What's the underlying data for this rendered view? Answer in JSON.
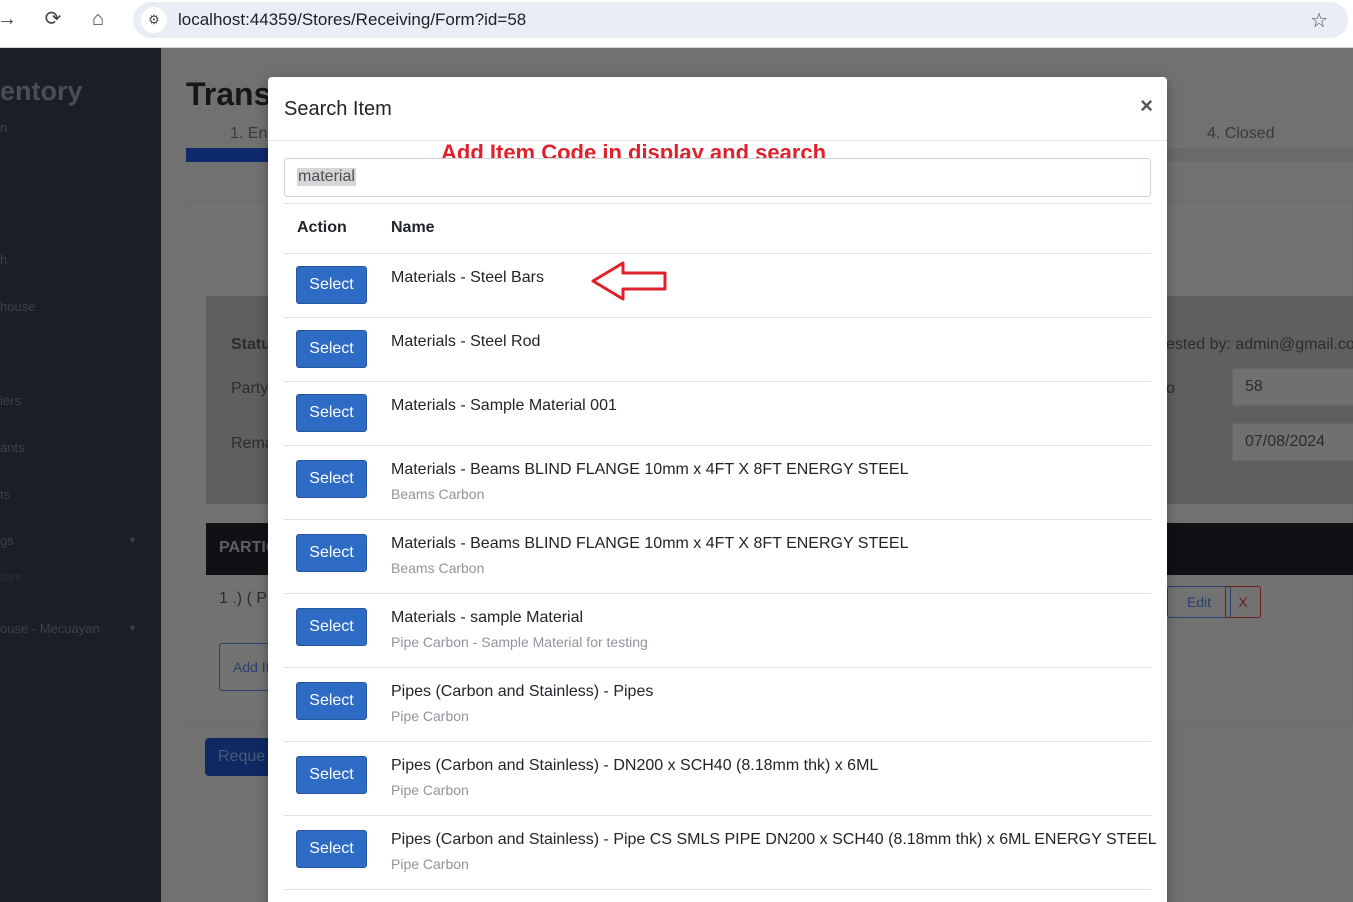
{
  "browser": {
    "url": "localhost:44359/Stores/Receiving/Form?id=58"
  },
  "sidebar": {
    "title": "entory",
    "items": [
      "n",
      "h",
      "house",
      "iers",
      "ants",
      "ts",
      "gs",
      "tore",
      "ouse - Mecuayan"
    ]
  },
  "background": {
    "page_title": "Trans",
    "steps": [
      "1. En",
      "4. Closed"
    ],
    "status_label": "Statu",
    "party_label": "Party",
    "remarks_label": "Rema",
    "requested_by": "ested by: admin@gmail.co",
    "right_label": "o",
    "id_value": "58",
    "date_value": "07/08/2024",
    "particulars_header": "PARTIC",
    "particular_row": "1 .) ( P",
    "edit_label": "Edit",
    "remove_label": "X",
    "add_item_label": "Add It",
    "request_label": "Reque"
  },
  "modal": {
    "title": "Search Item",
    "close_label": "×",
    "annotation": "Add Item Code in display and search",
    "search_value": "material",
    "columns": [
      "Action",
      "Name"
    ],
    "select_label": "Select",
    "items": [
      {
        "name": "Materials - Steel Bars",
        "sub": ""
      },
      {
        "name": "Materials - Steel Rod",
        "sub": ""
      },
      {
        "name": "Materials - Sample Material 001",
        "sub": ""
      },
      {
        "name": "Materials - Beams BLIND FLANGE 10mm x 4FT X 8FT ENERGY STEEL",
        "sub": "Beams Carbon"
      },
      {
        "name": "Materials - Beams BLIND FLANGE 10mm x 4FT X 8FT ENERGY STEEL",
        "sub": "Beams Carbon"
      },
      {
        "name": "Materials - sample Material",
        "sub": "Pipe Carbon - Sample Material for testing"
      },
      {
        "name": "Pipes (Carbon and Stainless) - Pipes",
        "sub": "Pipe Carbon"
      },
      {
        "name": "Pipes (Carbon and Stainless) - DN200 x SCH40 (8.18mm thk) x 6ML",
        "sub": "Pipe Carbon"
      },
      {
        "name": "Pipes (Carbon and Stainless) - Pipe CS SMLS PIPE DN200 x SCH40 (8.18mm thk) x 6ML ENERGY STEEL",
        "sub": "Pipe Carbon"
      }
    ]
  },
  "icons": {
    "back": "back-arrow-icon",
    "reload": "reload-icon",
    "home": "home-icon",
    "site_settings": "site-settings-icon",
    "bookmark": "star-icon",
    "annotation_arrow": "left-arrow-icon"
  },
  "colors": {
    "primary_button": "#2e6bc4",
    "annotation": "#e0202a"
  }
}
